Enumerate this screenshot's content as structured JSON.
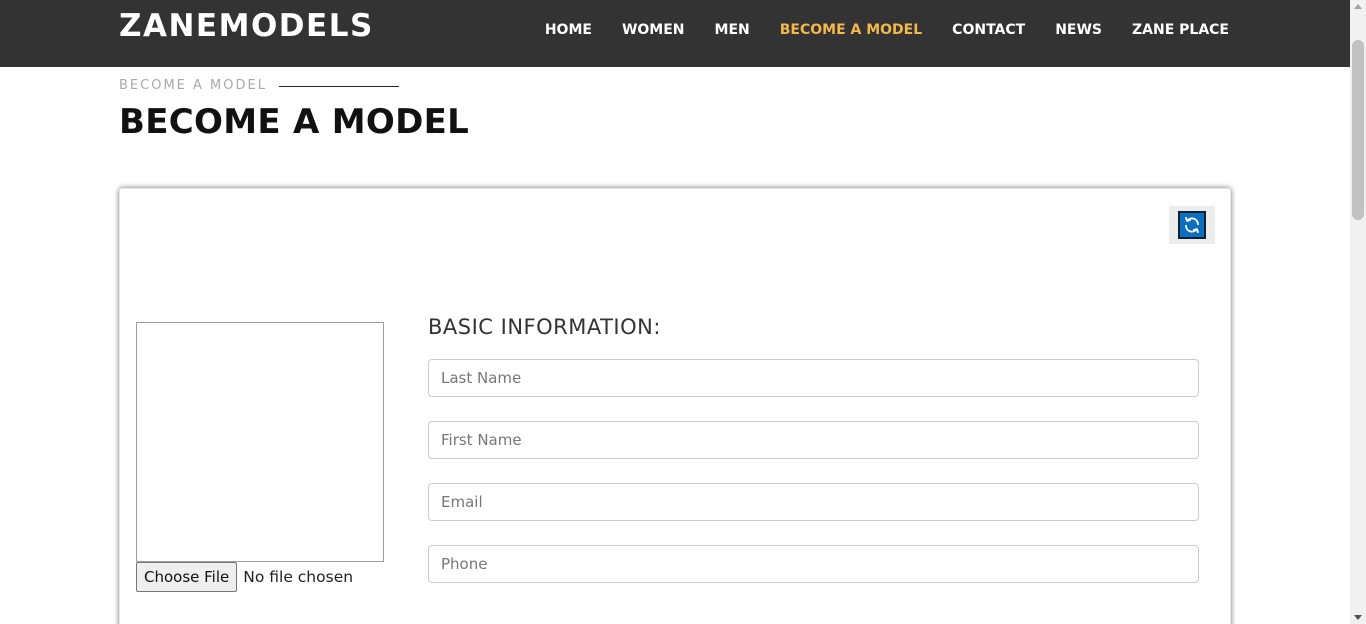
{
  "nav": {
    "brand": "ZANEMODELS",
    "links": [
      {
        "label": "HOME",
        "active": false
      },
      {
        "label": "WOMEN",
        "active": false
      },
      {
        "label": "MEN",
        "active": false
      },
      {
        "label": "BECOME A MODEL",
        "active": true
      },
      {
        "label": "CONTACT",
        "active": false
      },
      {
        "label": "NEWS",
        "active": false
      },
      {
        "label": "ZANE PLACE",
        "active": false
      }
    ]
  },
  "header": {
    "breadcrumb": "BECOME A MODEL",
    "title": "BECOME A MODEL"
  },
  "form": {
    "refresh_icon": "refresh-icon",
    "file_button": "Choose File",
    "file_status": "No file chosen",
    "section_title": "BASIC INFORMATION:",
    "fields": {
      "last_name": {
        "placeholder": "Last Name"
      },
      "first_name": {
        "placeholder": "First Name"
      },
      "email": {
        "placeholder": "Email"
      },
      "phone": {
        "placeholder": "Phone"
      }
    }
  },
  "colors": {
    "navbar": "#333333",
    "active_link": "#f2b84b",
    "refresh_button": "#0b6fc0"
  }
}
